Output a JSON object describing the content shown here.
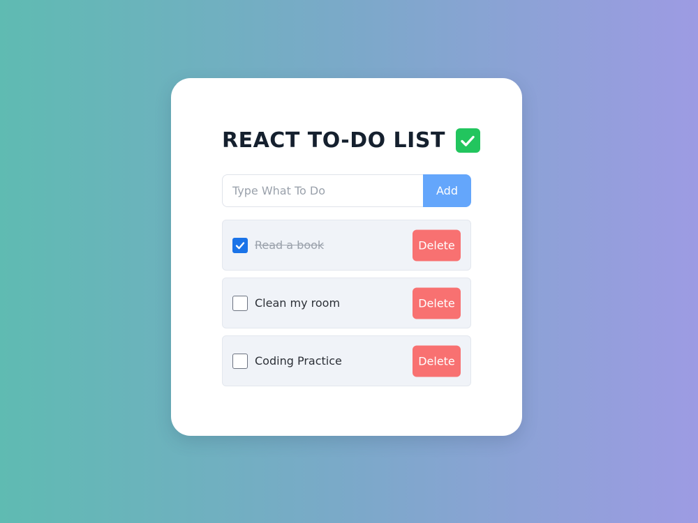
{
  "app": {
    "title": "REACT TO-DO LIST",
    "title_icon": "check-mark-button-icon"
  },
  "form": {
    "input_value": "",
    "input_placeholder": "Type What To Do",
    "add_label": "Add"
  },
  "todos": [
    {
      "text": "Read a book",
      "completed": true,
      "delete_label": "Delete"
    },
    {
      "text": "Clean my room",
      "completed": false,
      "delete_label": "Delete"
    },
    {
      "text": "Coding Practice",
      "completed": false,
      "delete_label": "Delete"
    }
  ],
  "colors": {
    "add_button": "#64a6fb",
    "delete_button": "#f87171",
    "title_check": "#22c55e",
    "checkbox_checked": "#1a73e8"
  }
}
